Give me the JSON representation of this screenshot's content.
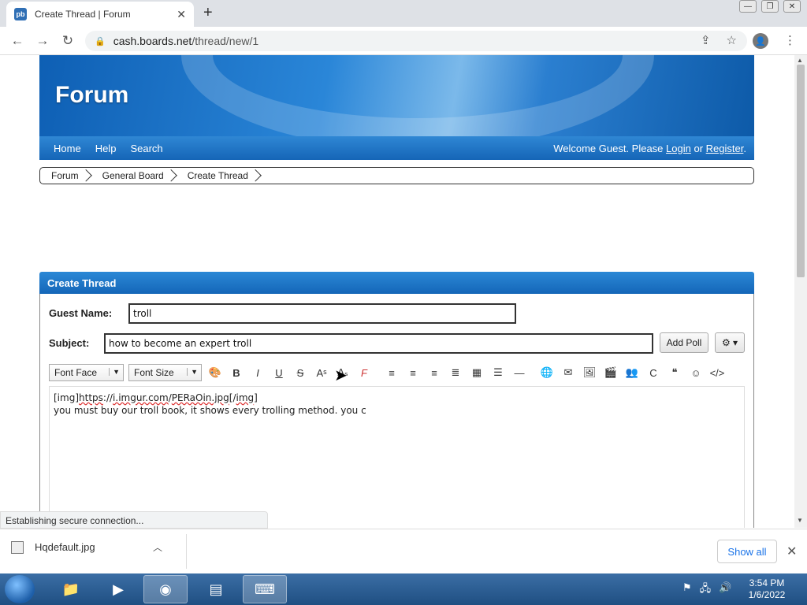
{
  "browser": {
    "tab_title": "Create Thread | Forum",
    "tab_favicon": "pb",
    "url_host": "cash.boards.net",
    "url_path": "/thread/new/1",
    "new_tab_symbol": "+",
    "close_symbol": "✕"
  },
  "site": {
    "logo": "Forum",
    "nav": [
      "Home",
      "Help",
      "Search"
    ],
    "welcome_prefix": "Welcome Guest. Please",
    "login": "Login",
    "or": "or",
    "register": "Register",
    "welcome_suffix": "."
  },
  "breadcrumb": [
    "Forum",
    "General Board",
    "Create Thread"
  ],
  "form": {
    "panel_title": "Create Thread",
    "guest_name_label": "Guest Name:",
    "guest_name_value": "troll",
    "subject_label": "Subject:",
    "subject_value": "how to become an expert troll",
    "add_poll": "Add Poll",
    "font_face": "Font Face",
    "font_size": "Font Size",
    "editor_line1_a": "[img]",
    "editor_line1_b": "https",
    "editor_line1_c": "://",
    "editor_line1_d": "i.imgur.com",
    "editor_line1_e": "/",
    "editor_line1_f": "PERaOin.jpg",
    "editor_line1_g": "[/",
    "editor_line1_h": "img",
    "editor_line1_i": "]",
    "editor_line2": "you must buy our troll book, it shows every trolling method. you c"
  },
  "status_bar": "Establishing secure connection...",
  "downloads": {
    "file": "Hqdefault.jpg",
    "show_all": "Show all"
  },
  "taskbar": {
    "time": "3:54 PM",
    "date": "1/6/2022"
  },
  "colors": {
    "accent_blue": "#1565b7",
    "link_blue": "#1a73e8"
  }
}
